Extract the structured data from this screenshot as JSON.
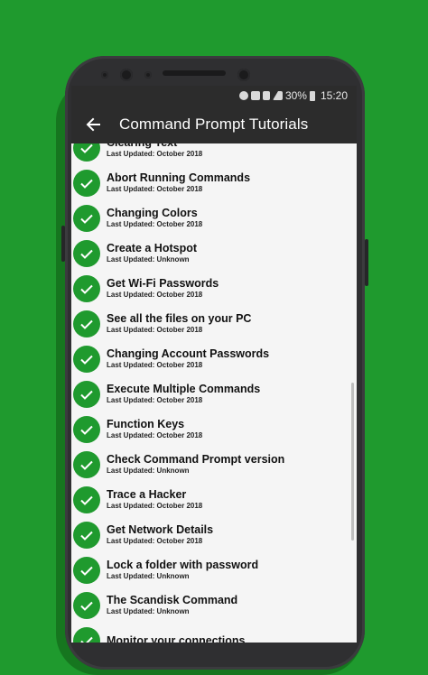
{
  "status_bar": {
    "battery": "30%",
    "time": "15:20"
  },
  "app_bar": {
    "title": "Command Prompt Tutorials"
  },
  "tutorials": [
    {
      "title": "Clearing Text",
      "updated": "Last Updated: October 2018"
    },
    {
      "title": "Abort Running Commands",
      "updated": "Last Updated: October 2018"
    },
    {
      "title": "Changing Colors",
      "updated": "Last Updated: October 2018"
    },
    {
      "title": "Create a Hotspot",
      "updated": "Last Updated: Unknown"
    },
    {
      "title": "Get Wi-Fi Passwords",
      "updated": "Last Updated: October 2018"
    },
    {
      "title": "See all the files on your PC",
      "updated": "Last Updated: October 2018"
    },
    {
      "title": "Changing Account Passwords",
      "updated": "Last Updated: October 2018"
    },
    {
      "title": "Execute Multiple Commands",
      "updated": "Last Updated: October 2018"
    },
    {
      "title": "Function Keys",
      "updated": "Last Updated: October 2018"
    },
    {
      "title": "Check Command Prompt version",
      "updated": "Last Updated: Unknown"
    },
    {
      "title": "Trace a Hacker",
      "updated": "Last Updated: October 2018"
    },
    {
      "title": "Get Network Details",
      "updated": "Last Updated: October 2018"
    },
    {
      "title": "Lock a folder with password",
      "updated": "Last Updated: Unknown"
    },
    {
      "title": "The Scandisk Command",
      "updated": "Last Updated: Unknown"
    },
    {
      "title": "Monitor your connections",
      "updated": ""
    }
  ],
  "colors": {
    "background": "#1f9a2e",
    "accent": "#1f9a2e",
    "app_bar": "#2c2c2c",
    "list_bg": "#f5f5f5"
  },
  "icons": {
    "back": "arrow-left-icon",
    "completed": "check-icon"
  }
}
